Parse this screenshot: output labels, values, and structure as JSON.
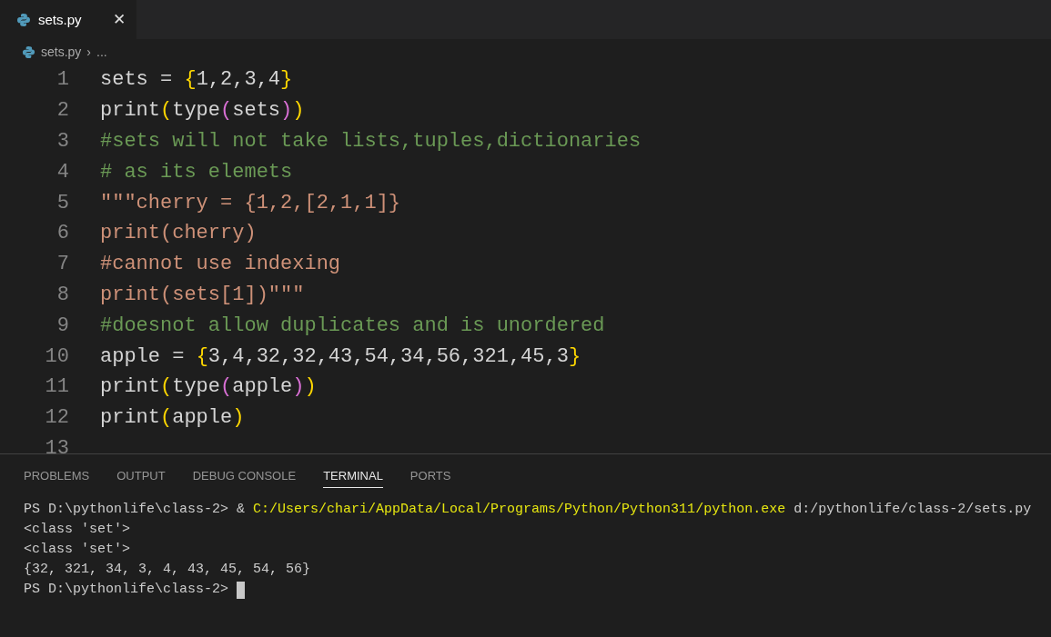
{
  "tabs": [
    {
      "label": "sets.py",
      "close": "✕",
      "selected": true
    }
  ],
  "breadcrumb": {
    "file": "sets.py",
    "separator": "›",
    "rest": "..."
  },
  "code_lines": [
    {
      "number": "1",
      "tokens": [
        {
          "kind": "text",
          "text": "sets = "
        },
        {
          "kind": "bracket1",
          "text": "{"
        },
        {
          "kind": "text",
          "text": "1,2,3,4"
        },
        {
          "kind": "bracket1",
          "text": "}"
        }
      ]
    },
    {
      "number": "2",
      "tokens": [
        {
          "kind": "text",
          "text": "print"
        },
        {
          "kind": "bracket1",
          "text": "("
        },
        {
          "kind": "text",
          "text": "type"
        },
        {
          "kind": "bracket2",
          "text": "("
        },
        {
          "kind": "text",
          "text": "sets"
        },
        {
          "kind": "bracket2",
          "text": ")"
        },
        {
          "kind": "bracket1",
          "text": ")"
        }
      ]
    },
    {
      "number": "3",
      "tokens": [
        {
          "kind": "comment",
          "text": "#sets will not take lists,tuples,dictionaries"
        }
      ]
    },
    {
      "number": "4",
      "tokens": [
        {
          "kind": "comment",
          "text": "# as its elemets"
        }
      ]
    },
    {
      "number": "5",
      "tokens": [
        {
          "kind": "string",
          "text": "\"\"\"cherry = {1,2,[2,1,1]}"
        }
      ]
    },
    {
      "number": "6",
      "tokens": [
        {
          "kind": "string",
          "text": "print(cherry)"
        }
      ]
    },
    {
      "number": "7",
      "tokens": [
        {
          "kind": "string",
          "text": "#cannot use indexing"
        }
      ]
    },
    {
      "number": "8",
      "tokens": [
        {
          "kind": "string",
          "text": "print(sets[1])\"\"\""
        }
      ]
    },
    {
      "number": "9",
      "tokens": [
        {
          "kind": "comment",
          "text": "#doesnot allow duplicates and is unordered"
        }
      ]
    },
    {
      "number": "10",
      "tokens": [
        {
          "kind": "text",
          "text": "apple = "
        },
        {
          "kind": "bracket1",
          "text": "{"
        },
        {
          "kind": "text",
          "text": "3,4,32,32,43,54,34,56,321,45,3"
        },
        {
          "kind": "bracket1",
          "text": "}"
        }
      ]
    },
    {
      "number": "11",
      "tokens": [
        {
          "kind": "text",
          "text": "print"
        },
        {
          "kind": "bracket1",
          "text": "("
        },
        {
          "kind": "text",
          "text": "type"
        },
        {
          "kind": "bracket2",
          "text": "("
        },
        {
          "kind": "text",
          "text": "apple"
        },
        {
          "kind": "bracket2",
          "text": ")"
        },
        {
          "kind": "bracket1",
          "text": ")"
        }
      ]
    },
    {
      "number": "12",
      "tokens": [
        {
          "kind": "text",
          "text": "print"
        },
        {
          "kind": "bracket1",
          "text": "("
        },
        {
          "kind": "text",
          "text": "apple"
        },
        {
          "kind": "bracket1",
          "text": ")"
        }
      ]
    },
    {
      "number": "13"
    }
  ],
  "panel_tabs": [
    {
      "label": "PROBLEMS",
      "selected": false
    },
    {
      "label": "OUTPUT",
      "selected": false
    },
    {
      "label": "DEBUG CONSOLE",
      "selected": false
    },
    {
      "label": "TERMINAL",
      "selected": true
    },
    {
      "label": "PORTS",
      "selected": false
    }
  ],
  "terminal_lines": [
    {
      "segments": [
        {
          "kind": "plain",
          "text": "PS D:\\pythonlife\\class-2> & "
        },
        {
          "kind": "command",
          "text": "C:/Users/chari/AppData/Local/Programs/Python/Python311/python.exe"
        },
        {
          "kind": "plain",
          "text": " d:/pythonlife/class-2/sets.py"
        }
      ]
    },
    {
      "segments": [
        {
          "kind": "plain",
          "text": "<class 'set'>"
        }
      ]
    },
    {
      "segments": [
        {
          "kind": "plain",
          "text": "<class 'set'>"
        }
      ]
    },
    {
      "segments": [
        {
          "kind": "plain",
          "text": "{32, 321, 34, 3, 4, 43, 45, 54, 56}"
        }
      ]
    },
    {
      "segments": [
        {
          "kind": "plain",
          "text": "PS D:\\pythonlife\\class-2> "
        }
      ],
      "cursor": true
    }
  ]
}
